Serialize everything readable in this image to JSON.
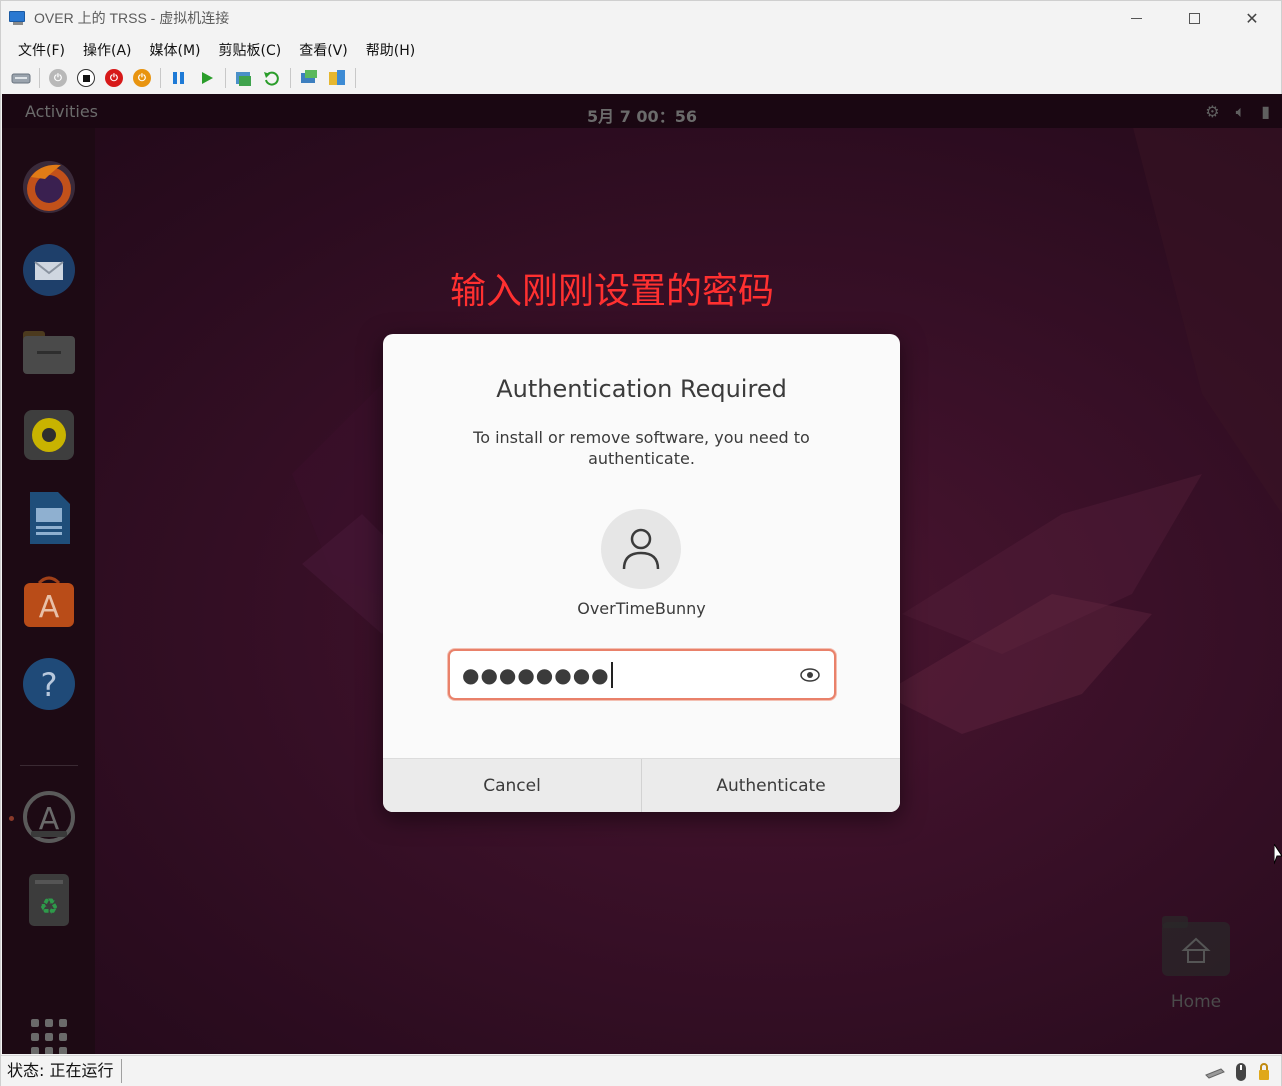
{
  "window": {
    "title": "OVER 上的 TRSS - 虚拟机连接"
  },
  "menubar": {
    "items": [
      "文件(F)",
      "操作(A)",
      "媒体(M)",
      "剪贴板(C)",
      "查看(V)",
      "帮助(H)"
    ]
  },
  "vm": {
    "topbar": {
      "activities": "Activities",
      "clock": "5月 7  00：56"
    },
    "annotation": "输入刚刚设置的密码",
    "desktop": {
      "home_label": "Home"
    }
  },
  "dialog": {
    "title": "Authentication Required",
    "message": "To install or remove software, you need to authenticate.",
    "username": "OverTimeBunny",
    "password_mask": "●●●●●●●●",
    "cancel_label": "Cancel",
    "authenticate_label": "Authenticate"
  },
  "statusbar": {
    "status": "状态: 正在运行"
  },
  "colors": {
    "accent_field_border": "#e9816a",
    "annotation_red": "#ff3030",
    "desktop_bg": "#2b0c1f"
  }
}
